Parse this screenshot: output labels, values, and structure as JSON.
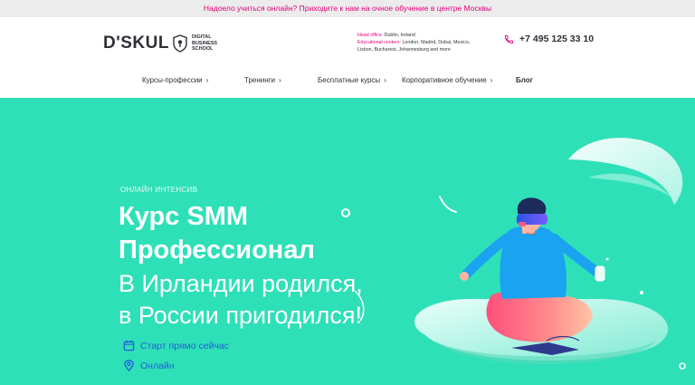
{
  "banner": {
    "text": "Надоело учиться онлайн? Приходите к нам на очное обучение в центре Москвы"
  },
  "header": {
    "logo_text": "D'SKUL",
    "logo_sub": "DIGITAL BUSINESS SCHOOL",
    "head_office_label": "Head office:",
    "head_office": "Dublin, Ireland",
    "edu_centers_label": "Educational centers:",
    "edu_centers": "London, Madrid, Dubai, Mexico, Lisbon, Bucharest, Johannesburg and more",
    "phone": "+7 495 125 33 10"
  },
  "nav": {
    "items": [
      {
        "label": "Курсы-профессии"
      },
      {
        "label": "Тренинги"
      },
      {
        "label": "Бесплатные курсы"
      },
      {
        "label": "Корпоративное обучение"
      },
      {
        "label": "Блог"
      }
    ]
  },
  "hero": {
    "label": "ОНЛАЙН ИНТЕНСИВ",
    "title_line1": "Курс SMM",
    "title_line2": "Профессионал",
    "sub_line1": "В Ирландии родился,",
    "sub_line2": "в России пригодился!",
    "features": [
      {
        "icon": "calendar-icon",
        "text": "Старт прямо сейчас"
      },
      {
        "icon": "location-pin-icon",
        "text": "Онлайн"
      }
    ]
  },
  "colors": {
    "accent_pink": "#e6007e",
    "hero_bg": "#2ee0b8",
    "feature_blue": "#1f5fd6",
    "dark_text": "#2f2f38"
  }
}
